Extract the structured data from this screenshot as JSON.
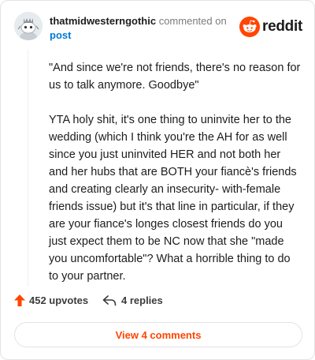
{
  "header": {
    "username": "thatmidwesterngothic",
    "action_text": "commented on",
    "post_link": "post",
    "brand": "reddit"
  },
  "comment": {
    "paragraphs": [
      "\"And since we're not friends, there's no reason for us to talk anymore. Goodbye\"",
      "YTA holy shit, it's one thing to uninvite her to the wedding (which I think you're the AH for as well since you just uninvited HER and not both her and her hubs that are BOTH your fiancè's friends and creating clearly an insecurity- with-female friends issue) but it's that line in particular, if they are your fiance's longes closest friends do you just expect them to be NC now that she \"made you uncomfortable\"? What a horrible thing to do to your partner."
    ]
  },
  "actions": {
    "upvotes_label": "452 upvotes",
    "replies_label": "4 replies",
    "upvote_icon": "upvote-arrow-icon",
    "reply_icon": "reply-arrow-icon"
  },
  "footer": {
    "view_comments_label": "View 4 comments"
  },
  "colors": {
    "brand_orange": "#ff4500",
    "link_blue": "#0079d3"
  }
}
